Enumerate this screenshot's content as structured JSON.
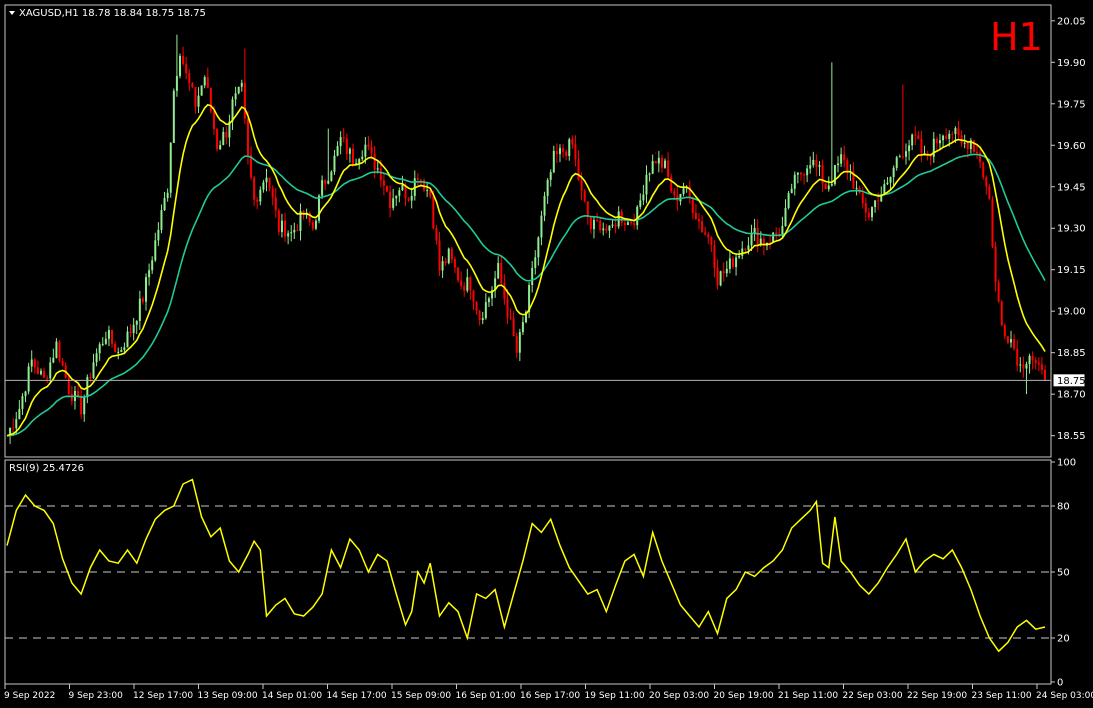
{
  "symbol_header": "XAGUSD,H1  18.78 18.84 18.75 18.75",
  "timeframe_badge": "H1",
  "rsi_header": "RSI(9) 25.4726",
  "current_price_label": "18.75",
  "colors": {
    "background": "#000000",
    "bull": "#90ee90",
    "bear": "#ff0000",
    "ma_fast": "#ffff00",
    "ma_slow": "#20c997",
    "rsi": "#ffff00",
    "badge": "#ff0000",
    "axis_text": "#ffffff"
  },
  "chart_data": [
    {
      "type": "candlestick",
      "ylim": [
        18.48,
        20.1
      ],
      "y_ticks": [
        "20.05",
        "19.90",
        "19.75",
        "19.60",
        "19.45",
        "19.30",
        "19.15",
        "19.00",
        "18.85",
        "18.70",
        "18.55"
      ],
      "x_ticks": [
        "9 Sep 2022",
        "9 Sep 23:00",
        "12 Sep 17:00",
        "13 Sep 09:00",
        "14 Sep 01:00",
        "14 Sep 17:00",
        "15 Sep 09:00",
        "16 Sep 01:00",
        "16 Sep 17:00",
        "19 Sep 11:00",
        "20 Sep 03:00",
        "20 Sep 19:00",
        "21 Sep 11:00",
        "22 Sep 03:00",
        "22 Sep 19:00",
        "23 Sep 11:00",
        "24 Sep 03:00"
      ],
      "last_price": 18.75,
      "close_path": [
        [
          0,
          18.55
        ],
        [
          4,
          18.65
        ],
        [
          8,
          18.82
        ],
        [
          12,
          18.75
        ],
        [
          16,
          18.88
        ],
        [
          20,
          18.72
        ],
        [
          24,
          18.65
        ],
        [
          28,
          18.82
        ],
        [
          32,
          18.92
        ],
        [
          36,
          18.85
        ],
        [
          40,
          18.93
        ],
        [
          44,
          19.05
        ],
        [
          48,
          19.25
        ],
        [
          52,
          19.45
        ],
        [
          54,
          19.8
        ],
        [
          56,
          19.95
        ],
        [
          58,
          19.85
        ],
        [
          61,
          19.75
        ],
        [
          64,
          19.85
        ],
        [
          68,
          19.6
        ],
        [
          71,
          19.65
        ],
        [
          73,
          19.75
        ],
        [
          76,
          19.8
        ],
        [
          78,
          19.55
        ],
        [
          80,
          19.4
        ],
        [
          84,
          19.5
        ],
        [
          88,
          19.3
        ],
        [
          90,
          19.3
        ],
        [
          92,
          19.28
        ],
        [
          96,
          19.35
        ],
        [
          99,
          19.3
        ],
        [
          102,
          19.45
        ],
        [
          106,
          19.55
        ],
        [
          108,
          19.62
        ],
        [
          112,
          19.55
        ],
        [
          116,
          19.6
        ],
        [
          118,
          19.55
        ],
        [
          121,
          19.5
        ],
        [
          124,
          19.4
        ],
        [
          127,
          19.45
        ],
        [
          130,
          19.42
        ],
        [
          133,
          19.5
        ],
        [
          137,
          19.42
        ],
        [
          140,
          19.15
        ],
        [
          143,
          19.2
        ],
        [
          147,
          19.1
        ],
        [
          150,
          19.1
        ],
        [
          153,
          18.98
        ],
        [
          156,
          19.05
        ],
        [
          159,
          19.15
        ],
        [
          162,
          19.0
        ],
        [
          165,
          18.85
        ],
        [
          168,
          19.0
        ],
        [
          171,
          19.2
        ],
        [
          174,
          19.4
        ],
        [
          177,
          19.55
        ],
        [
          180,
          19.58
        ],
        [
          183,
          19.6
        ],
        [
          186,
          19.42
        ],
        [
          189,
          19.3
        ],
        [
          192,
          19.32
        ],
        [
          195,
          19.28
        ],
        [
          198,
          19.35
        ],
        [
          201,
          19.32
        ],
        [
          204,
          19.35
        ],
        [
          207,
          19.5
        ],
        [
          210,
          19.55
        ],
        [
          213,
          19.52
        ],
        [
          216,
          19.4
        ],
        [
          219,
          19.45
        ],
        [
          222,
          19.38
        ],
        [
          225,
          19.3
        ],
        [
          228,
          19.25
        ],
        [
          230,
          19.12
        ],
        [
          233,
          19.15
        ],
        [
          236,
          19.2
        ],
        [
          239,
          19.25
        ],
        [
          242,
          19.28
        ],
        [
          245,
          19.25
        ],
        [
          248,
          19.27
        ],
        [
          251,
          19.3
        ],
        [
          254,
          19.45
        ],
        [
          257,
          19.5
        ],
        [
          260,
          19.55
        ],
        [
          263,
          19.5
        ],
        [
          265,
          19.45
        ],
        [
          267,
          19.48
        ],
        [
          270,
          19.55
        ],
        [
          273,
          19.5
        ],
        [
          276,
          19.4
        ],
        [
          279,
          19.35
        ],
        [
          282,
          19.42
        ],
        [
          285,
          19.45
        ],
        [
          288,
          19.55
        ],
        [
          291,
          19.6
        ],
        [
          294,
          19.62
        ],
        [
          297,
          19.55
        ],
        [
          300,
          19.6
        ],
        [
          303,
          19.65
        ],
        [
          306,
          19.65
        ],
        [
          309,
          19.6
        ],
        [
          312,
          19.62
        ],
        [
          315,
          19.55
        ],
        [
          318,
          19.4
        ],
        [
          320,
          19.1
        ],
        [
          322,
          18.95
        ],
        [
          325,
          18.9
        ],
        [
          328,
          18.8
        ],
        [
          331,
          18.85
        ],
        [
          334,
          18.78
        ],
        [
          336,
          18.75
        ]
      ],
      "spikes": [
        [
          55,
          20.0
        ],
        [
          77,
          19.95
        ],
        [
          104,
          19.66
        ],
        [
          210,
          19.57
        ],
        [
          267,
          19.9
        ],
        [
          290,
          19.82
        ],
        [
          330,
          18.7
        ]
      ]
    },
    {
      "type": "line",
      "title": "RSI(9) 25.4726",
      "ylim": [
        0,
        100
      ],
      "y_ticks": [
        "100",
        "80",
        "50",
        "20",
        "0"
      ],
      "levels": [
        80,
        50,
        20
      ],
      "values": [
        [
          0,
          62
        ],
        [
          3,
          78
        ],
        [
          6,
          85
        ],
        [
          9,
          80
        ],
        [
          12,
          78
        ],
        [
          15,
          72
        ],
        [
          18,
          56
        ],
        [
          21,
          45
        ],
        [
          24,
          40
        ],
        [
          27,
          52
        ],
        [
          30,
          60
        ],
        [
          33,
          55
        ],
        [
          36,
          54
        ],
        [
          39,
          60
        ],
        [
          42,
          54
        ],
        [
          45,
          65
        ],
        [
          48,
          74
        ],
        [
          51,
          78
        ],
        [
          54,
          80
        ],
        [
          57,
          90
        ],
        [
          60,
          92
        ],
        [
          63,
          75
        ],
        [
          66,
          66
        ],
        [
          69,
          70
        ],
        [
          72,
          55
        ],
        [
          75,
          50
        ],
        [
          78,
          58
        ],
        [
          80,
          64
        ],
        [
          82,
          60
        ],
        [
          84,
          30
        ],
        [
          87,
          35
        ],
        [
          90,
          38
        ],
        [
          93,
          31
        ],
        [
          96,
          30
        ],
        [
          99,
          34
        ],
        [
          102,
          40
        ],
        [
          105,
          60
        ],
        [
          108,
          52
        ],
        [
          111,
          65
        ],
        [
          114,
          60
        ],
        [
          117,
          50
        ],
        [
          120,
          58
        ],
        [
          123,
          55
        ],
        [
          126,
          40
        ],
        [
          129,
          26
        ],
        [
          131,
          32
        ],
        [
          133,
          50
        ],
        [
          135,
          45
        ],
        [
          137,
          54
        ],
        [
          140,
          30
        ],
        [
          143,
          36
        ],
        [
          146,
          32
        ],
        [
          149,
          20
        ],
        [
          152,
          40
        ],
        [
          155,
          38
        ],
        [
          158,
          42
        ],
        [
          161,
          25
        ],
        [
          164,
          40
        ],
        [
          167,
          55
        ],
        [
          170,
          72
        ],
        [
          173,
          68
        ],
        [
          176,
          74
        ],
        [
          179,
          62
        ],
        [
          182,
          52
        ],
        [
          185,
          46
        ],
        [
          188,
          40
        ],
        [
          191,
          42
        ],
        [
          194,
          32
        ],
        [
          197,
          44
        ],
        [
          200,
          55
        ],
        [
          203,
          58
        ],
        [
          206,
          48
        ],
        [
          209,
          68
        ],
        [
          212,
          55
        ],
        [
          215,
          45
        ],
        [
          218,
          35
        ],
        [
          221,
          30
        ],
        [
          224,
          25
        ],
        [
          227,
          32
        ],
        [
          230,
          22
        ],
        [
          233,
          38
        ],
        [
          236,
          42
        ],
        [
          239,
          50
        ],
        [
          242,
          48
        ],
        [
          245,
          52
        ],
        [
          248,
          55
        ],
        [
          251,
          60
        ],
        [
          254,
          70
        ],
        [
          257,
          74
        ],
        [
          260,
          78
        ],
        [
          262,
          82
        ],
        [
          264,
          54
        ],
        [
          266,
          52
        ],
        [
          268,
          75
        ],
        [
          270,
          55
        ],
        [
          273,
          50
        ],
        [
          276,
          44
        ],
        [
          279,
          40
        ],
        [
          282,
          45
        ],
        [
          285,
          52
        ],
        [
          288,
          58
        ],
        [
          291,
          65
        ],
        [
          294,
          50
        ],
        [
          297,
          55
        ],
        [
          300,
          58
        ],
        [
          303,
          56
        ],
        [
          306,
          60
        ],
        [
          309,
          52
        ],
        [
          312,
          42
        ],
        [
          315,
          30
        ],
        [
          318,
          20
        ],
        [
          321,
          14
        ],
        [
          324,
          18
        ],
        [
          327,
          25
        ],
        [
          330,
          28
        ],
        [
          333,
          24
        ],
        [
          336,
          25
        ]
      ]
    }
  ]
}
